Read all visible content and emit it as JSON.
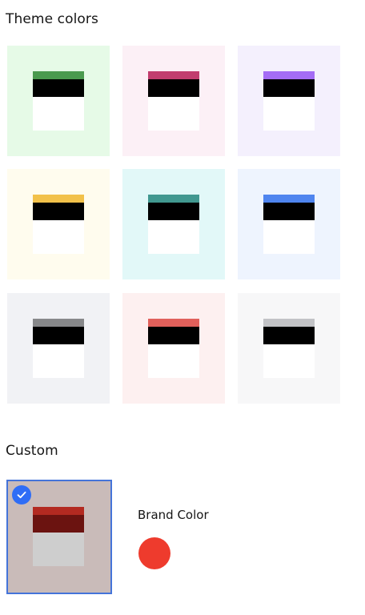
{
  "theme_section": {
    "title": "Theme colors",
    "themes": [
      {
        "name": "green",
        "background": "#e6fae7",
        "accent": "#4a9a4e"
      },
      {
        "name": "pink",
        "background": "#fcf0f6",
        "accent": "#c13d6e"
      },
      {
        "name": "purple",
        "background": "#f4f0fd",
        "accent": "#a46cf5"
      },
      {
        "name": "yellow",
        "background": "#fffcee",
        "accent": "#f2c14a"
      },
      {
        "name": "teal",
        "background": "#e2f8f8",
        "accent": "#419890"
      },
      {
        "name": "blue",
        "background": "#eef4fe",
        "accent": "#4f85ef"
      },
      {
        "name": "gray",
        "background": "#f1f2f5",
        "accent": "#87888a"
      },
      {
        "name": "red",
        "background": "#fdf0f0",
        "accent": "#e0605b"
      },
      {
        "name": "silver",
        "background": "#f7f7f8",
        "accent": "#c2c3c6"
      }
    ]
  },
  "custom_section": {
    "title": "Custom",
    "selected": true,
    "swatch": {
      "background": "#c9bbb9",
      "accent": "#b32a21",
      "header": "#6b1310",
      "content": "#cecece"
    },
    "brand_color_label": "Brand Color",
    "brand_color": "#ee3b2d"
  }
}
